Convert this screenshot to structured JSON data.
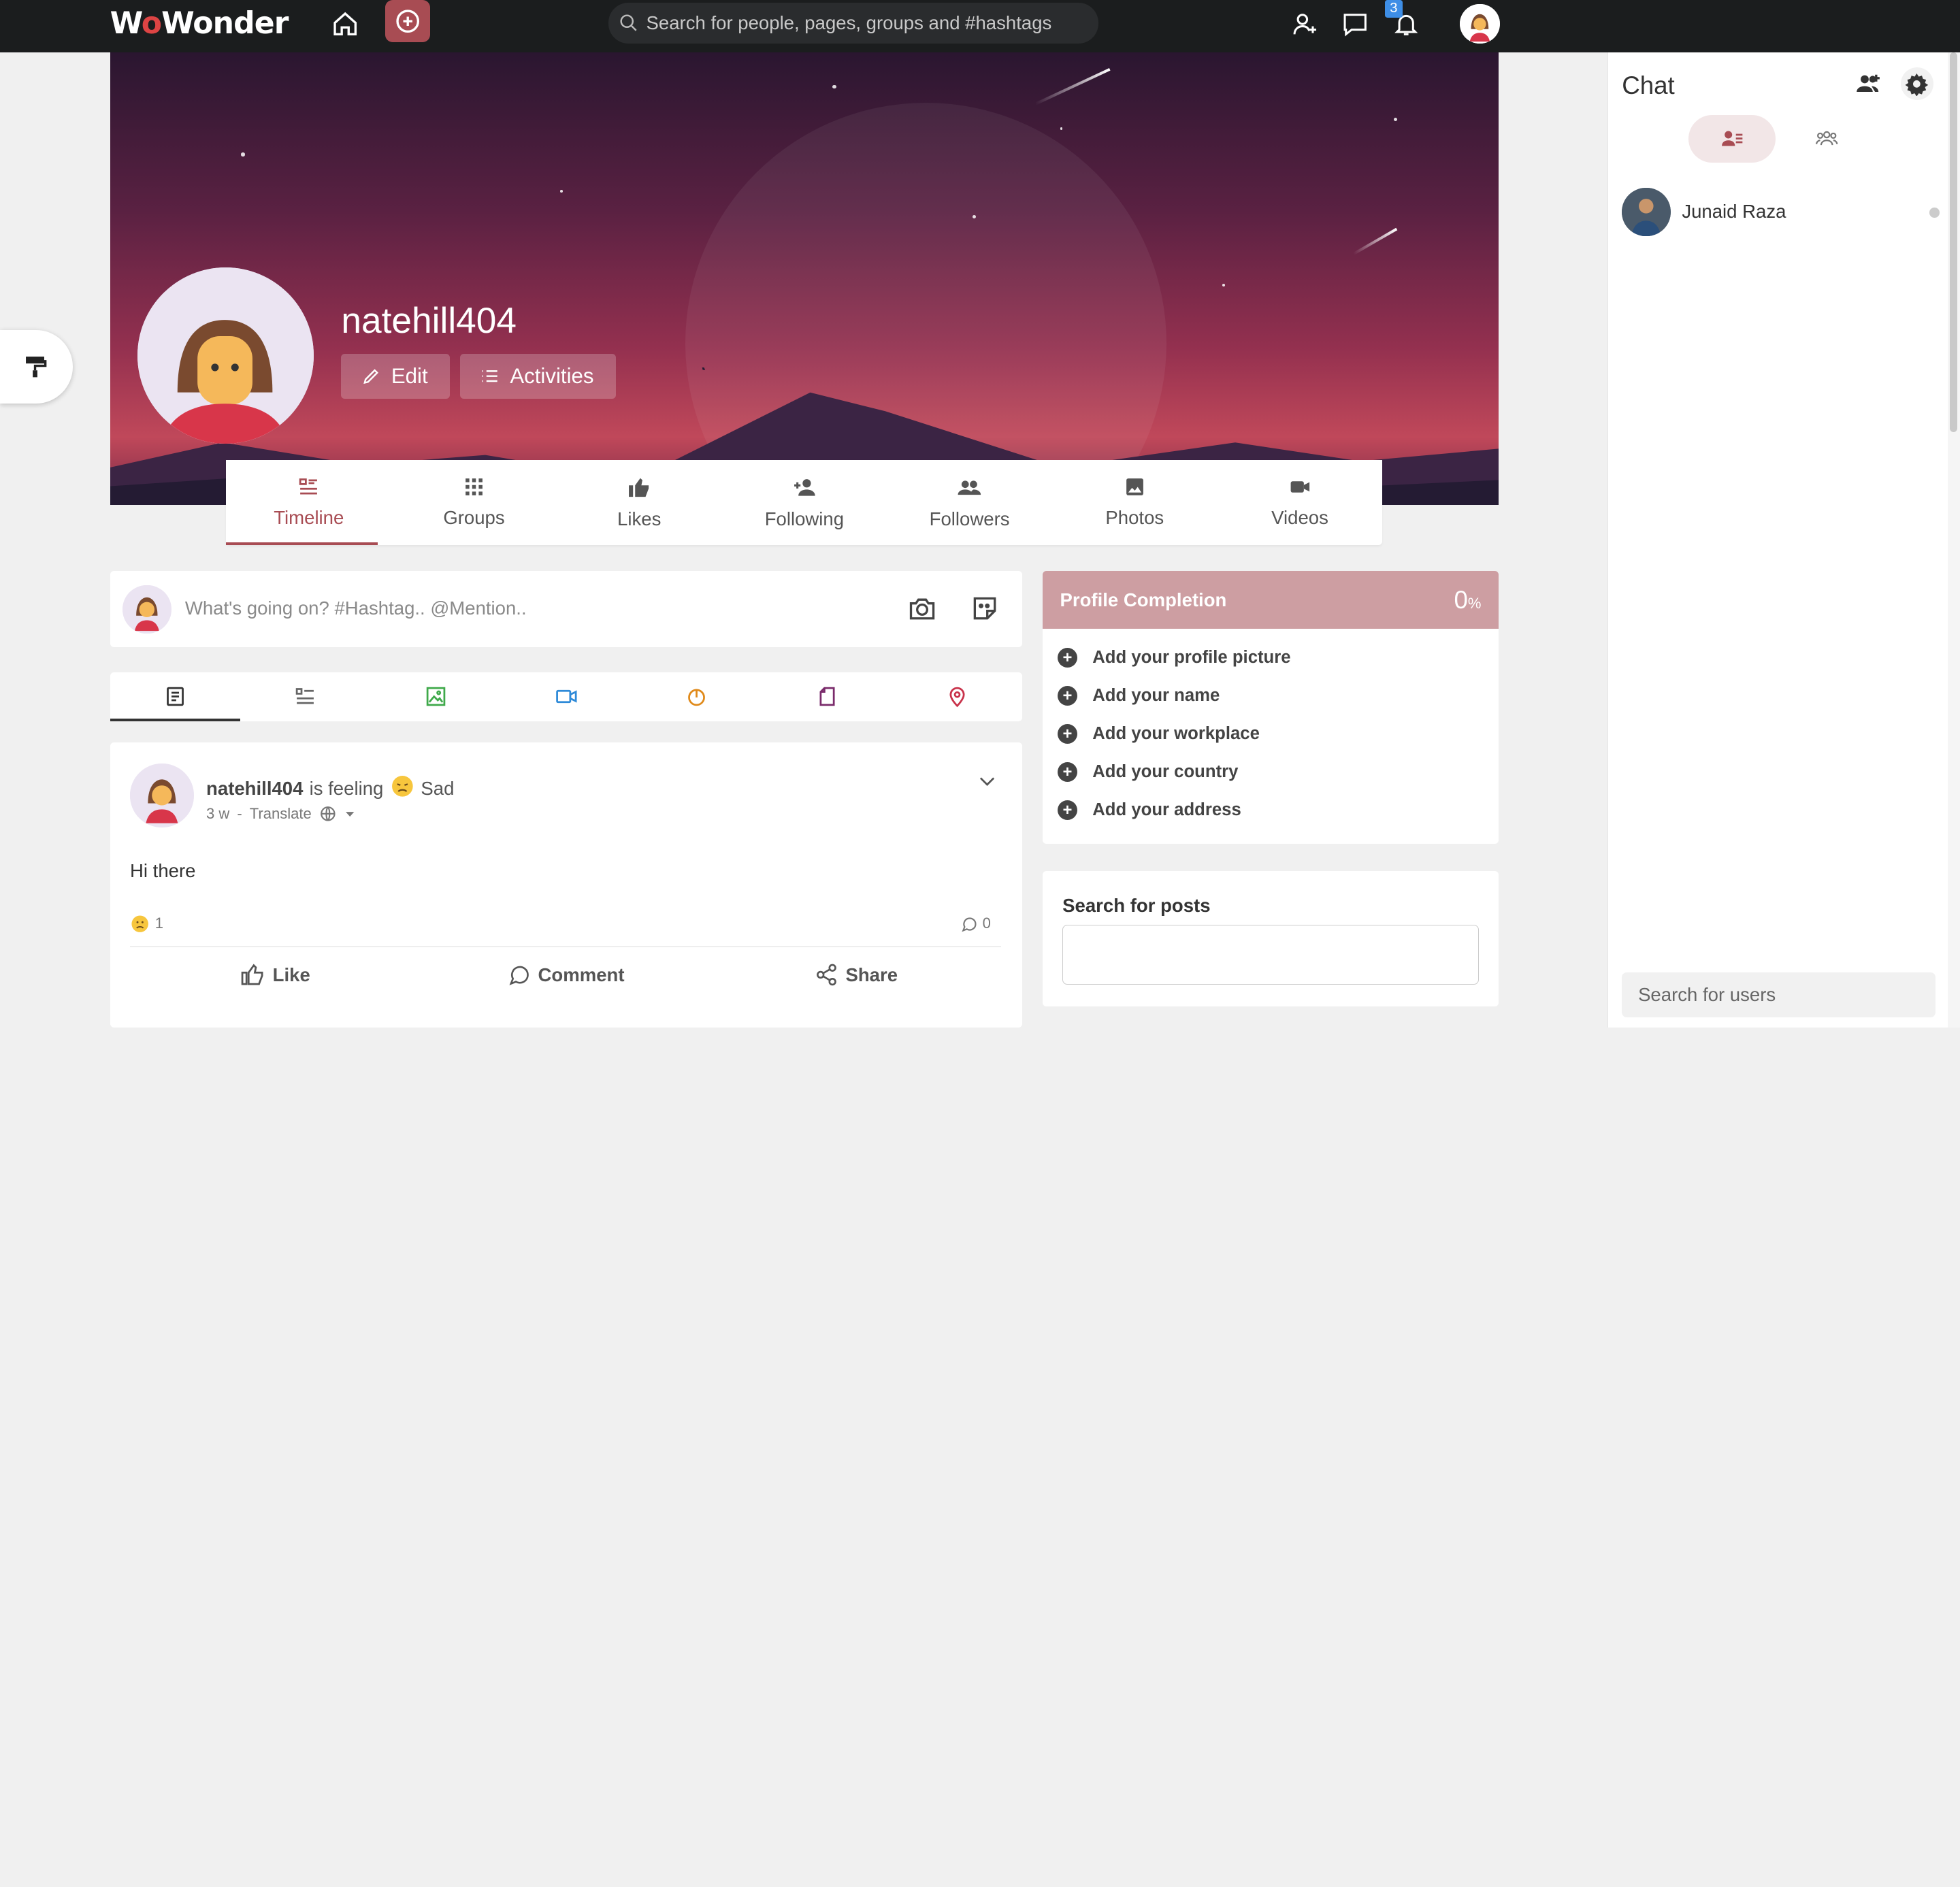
{
  "brand": {
    "logo_text_1": "W",
    "logo_o": "o",
    "logo_text_2": "Wonder"
  },
  "topbar": {
    "search_placeholder": "Search for people, pages, groups and #hashtags",
    "notification_count": "3",
    "icons": [
      "home-icon",
      "plus-circle-icon",
      "search-icon",
      "add-user-icon",
      "message-icon",
      "bell-icon"
    ]
  },
  "profile": {
    "username": "natehill404",
    "edit_label": "Edit",
    "activities_label": "Activities"
  },
  "tabs": [
    {
      "label": "Timeline",
      "icon": "timeline-icon",
      "active": true
    },
    {
      "label": "Groups",
      "icon": "groups-icon"
    },
    {
      "label": "Likes",
      "icon": "thumbs-up-icon"
    },
    {
      "label": "Following",
      "icon": "user-plus-icon"
    },
    {
      "label": "Followers",
      "icon": "users-icon"
    },
    {
      "label": "Photos",
      "icon": "photo-icon"
    },
    {
      "label": "Videos",
      "icon": "video-icon"
    }
  ],
  "publisher": {
    "placeholder": "What's going on? #Hashtag.. @Mention.."
  },
  "filters": [
    "all-posts-icon",
    "text-list-icon",
    "image-icon",
    "video-icon",
    "audio-icon",
    "file-icon",
    "location-icon"
  ],
  "post": {
    "username": "natehill404",
    "feeling_text": "is feeling",
    "feeling": "Sad",
    "time": "3 w",
    "translate": "Translate",
    "body": "Hi there",
    "reaction_count": "1",
    "comment_count": "0",
    "like_label": "Like",
    "comment_label": "Comment",
    "share_label": "Share"
  },
  "profile_completion": {
    "title": "Profile Completion",
    "percent": "0",
    "percent_sign": "%",
    "items": [
      "Add your profile picture",
      "Add your name",
      "Add your workplace",
      "Add your country",
      "Add your address"
    ]
  },
  "search_posts": {
    "title": "Search for posts",
    "value": ""
  },
  "chat": {
    "title": "Chat",
    "users": [
      {
        "name": "Junaid Raza",
        "online": false
      }
    ],
    "search_placeholder": "Search for users"
  },
  "colors": {
    "accent": "#a84c53",
    "topbar": "#1b1d1e",
    "completion_header": "#cd9ea2",
    "badge": "#3e8ee6"
  }
}
